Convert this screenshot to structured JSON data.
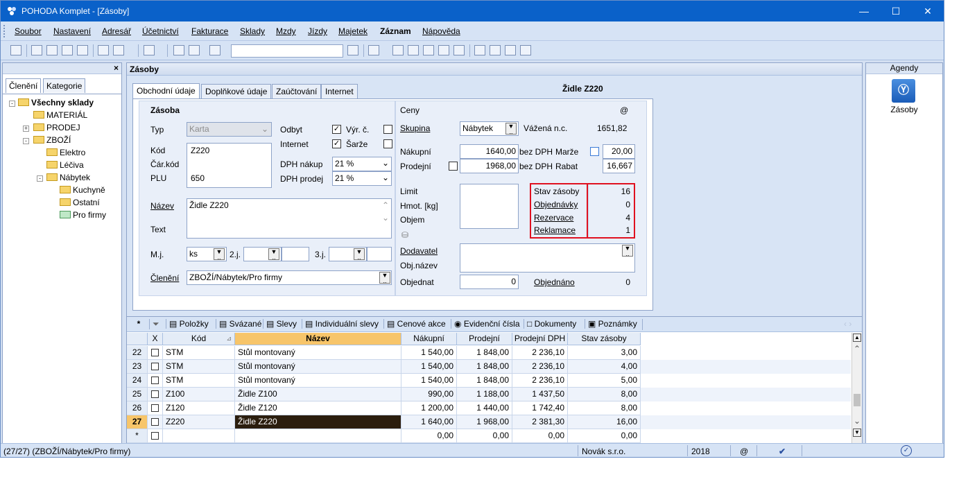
{
  "window": {
    "title": "POHODA Komplet - [Zásoby]"
  },
  "menu": [
    "Soubor",
    "Nastavení",
    "Adresář",
    "Účetnictví",
    "Fakturace",
    "Sklady",
    "Mzdy",
    "Jízdy",
    "Majetek",
    "Záznam",
    "Nápověda"
  ],
  "left": {
    "tabs": [
      "Členění",
      "Kategorie"
    ],
    "tree": [
      "Všechny sklady",
      "MATERIÁL",
      "PRODEJ",
      "ZBOŽÍ",
      "Elektro",
      "Léčiva",
      "Nábytek",
      "Kuchyně",
      "Ostatní",
      "Pro firmy"
    ]
  },
  "center": {
    "title": "Zásoby",
    "tabs": [
      "Obchodní údaje",
      "Doplňkové údaje",
      "Zaúčtování",
      "Internet"
    ],
    "record_title": "Židle Z220",
    "zasoba": {
      "section": "Zásoba",
      "typ_label": "Typ",
      "typ_value": "Karta",
      "kod_label": "Kód",
      "kod_value": "Z220",
      "carkod_label": "Čár.kód",
      "plu_label": "PLU",
      "plu_value": "650",
      "odbyt_label": "Odbyt",
      "internet_label": "Internet",
      "vyrc_label": "Výr. č.",
      "sarze_label": "Šarže",
      "dph_nakup_label": "DPH nákup",
      "dph_nakup_value": "21 %",
      "dph_prodej_label": "DPH prodej",
      "dph_prodej_value": "21 %",
      "nazev_label": "Název",
      "nazev_value": "Židle Z220",
      "text_label": "Text",
      "mj_label": "M.j.",
      "mj_value": "ks",
      "mj2_label": "2.j.",
      "mj3_label": "3.j.",
      "cleneni_label": "Členění",
      "cleneni_value": "ZBOŽÍ/Nábytek/Pro firmy"
    },
    "ceny": {
      "section": "Ceny",
      "at": "@",
      "skupina_label": "Skupina",
      "skupina_value": "Nábytek",
      "vazena_label": "Vážená n.c.",
      "vazena_value": "1651,82",
      "nakupni_label": "Nákupní",
      "nakupni_value": "1640,00",
      "bez_dph": "bez DPH",
      "marze_label": "Marže",
      "marze_value": "20,00",
      "prodejni_label": "Prodejní",
      "prodejni_value": "1968,00",
      "rabat_label": "Rabat",
      "rabat_value": "16,667",
      "limit_label": "Limit",
      "hmot_label": "Hmot. [kg]",
      "objem_label": "Objem",
      "stock": [
        {
          "label": "Stav zásoby",
          "value": "16"
        },
        {
          "label": "Objednávky",
          "value": "0"
        },
        {
          "label": "Rezervace",
          "value": "4"
        },
        {
          "label": "Reklamace",
          "value": "1"
        }
      ],
      "dodavatel_label": "Dodavatel",
      "objnazev_label": "Obj.název",
      "objednat_label": "Objednat",
      "objednat_value": "0",
      "objednano_label": "Objednáno",
      "objednano_value": "0"
    },
    "grid": {
      "tabs": [
        "Položky",
        "Svázané",
        "Slevy",
        "Individuální slevy",
        "Cenové akce",
        "Evidenční čísla",
        "Dokumenty",
        "Poznámky"
      ],
      "headers": [
        "X",
        "Kód",
        "Název",
        "Nákupní",
        "Prodejní",
        "Prodejní DPH",
        "Stav zásoby"
      ],
      "rows": [
        {
          "n": "22",
          "kod": "STM",
          "nazev": "Stůl montovaný",
          "nak": "1 540,00",
          "prod": "1 848,00",
          "dph": "2 236,10",
          "stav": "3,00"
        },
        {
          "n": "23",
          "kod": "STM",
          "nazev": "Stůl montovaný",
          "nak": "1 540,00",
          "prod": "1 848,00",
          "dph": "2 236,10",
          "stav": "4,00"
        },
        {
          "n": "24",
          "kod": "STM",
          "nazev": "Stůl montovaný",
          "nak": "1 540,00",
          "prod": "1 848,00",
          "dph": "2 236,10",
          "stav": "5,00"
        },
        {
          "n": "25",
          "kod": "Z100",
          "nazev": "Židle Z100",
          "nak": "990,00",
          "prod": "1 188,00",
          "dph": "1 437,50",
          "stav": "8,00"
        },
        {
          "n": "26",
          "kod": "Z120",
          "nazev": "Židle Z120",
          "nak": "1 200,00",
          "prod": "1 440,00",
          "dph": "1 742,40",
          "stav": "8,00"
        },
        {
          "n": "27",
          "kod": "Z220",
          "nazev": "Židle Z220",
          "nak": "1 640,00",
          "prod": "1 968,00",
          "dph": "2 381,30",
          "stav": "16,00"
        }
      ],
      "new_row": {
        "n": "*",
        "nak": "0,00",
        "prod": "0,00",
        "dph": "0,00",
        "stav": "0,00"
      }
    }
  },
  "right": {
    "title": "Agendy",
    "item": "Zásoby"
  },
  "status": {
    "path": "(27/27) (ZBOŽÍ/Nábytek/Pro firmy)",
    "company": "Novák s.r.o.",
    "year": "2018",
    "at": "@"
  }
}
